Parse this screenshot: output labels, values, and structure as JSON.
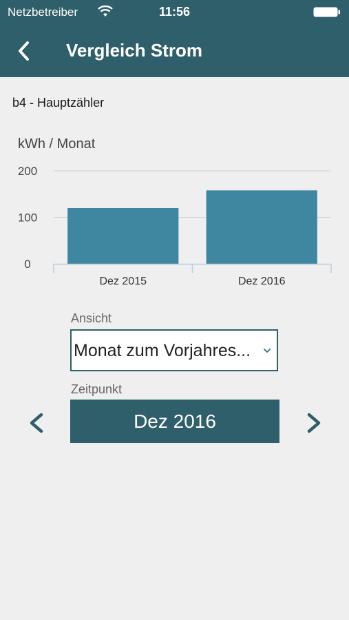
{
  "statusbar": {
    "carrier": "Netzbetreiber",
    "time": "11:56",
    "icons": [
      "wifi-icon",
      "battery-icon"
    ]
  },
  "navbar": {
    "title": "Vergleich Strom",
    "back_icon": "chevron-left-icon"
  },
  "meter_name": "b4 - Hauptzähler",
  "chart": {
    "unit_label": "kWh / Monat"
  },
  "chart_data": {
    "type": "bar",
    "categories": [
      "Dez 2015",
      "Dez 2016"
    ],
    "values": [
      120,
      158
    ],
    "title": "",
    "xlabel": "",
    "ylabel": "kWh / Monat",
    "ylim": [
      0,
      200
    ],
    "yticks": [
      0,
      100,
      200
    ],
    "grid": true,
    "bar_color": "#3f86a1"
  },
  "view": {
    "label": "Ansicht",
    "selected": "Monat zum Vorjahres...",
    "chevron_icon": "chevron-down-icon"
  },
  "period": {
    "label": "Zeitpunkt",
    "value": "Dez 2016",
    "prev_icon": "chevron-left-icon",
    "next_icon": "chevron-right-icon"
  },
  "colors": {
    "header": "#2e5f6a",
    "accent": "#2e5f6a",
    "background": "#efefef"
  }
}
